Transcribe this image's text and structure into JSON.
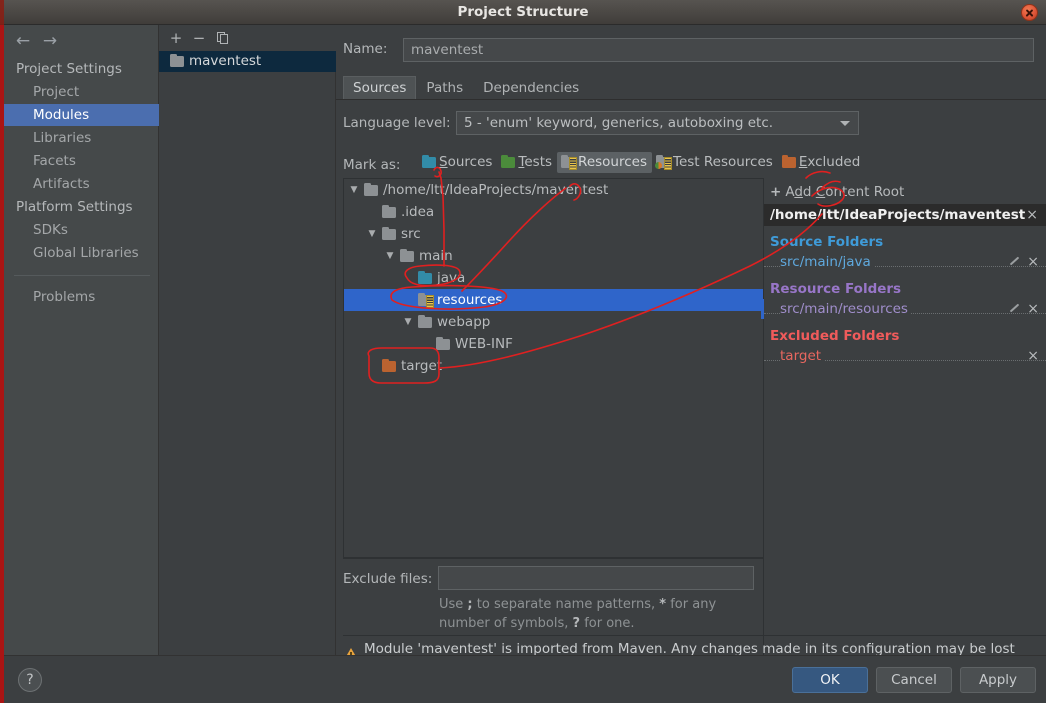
{
  "window": {
    "title": "Project Structure",
    "close_icon": "close-icon"
  },
  "sidebar": {
    "back_icon": "←",
    "forward_icon": "→",
    "groups": [
      {
        "label": "Project Settings"
      },
      {
        "label": "Platform Settings"
      }
    ],
    "items": [
      {
        "label": "Project",
        "selected": false
      },
      {
        "label": "Modules",
        "selected": true
      },
      {
        "label": "Libraries",
        "selected": false
      },
      {
        "label": "Facets",
        "selected": false
      },
      {
        "label": "Artifacts",
        "selected": false
      },
      {
        "label": "SDKs",
        "selected": false
      },
      {
        "label": "Global Libraries",
        "selected": false
      },
      {
        "label": "Problems",
        "selected": false
      }
    ]
  },
  "module_list": {
    "toolbar": {
      "add": "+",
      "remove": "−",
      "copy": "copy-icon"
    },
    "modules": [
      {
        "label": "maventest",
        "selected": true
      }
    ]
  },
  "module_editor": {
    "name_label": "Name:",
    "name_value": "maventest",
    "tabs": [
      {
        "label": "Sources",
        "active": true
      },
      {
        "label": "Paths",
        "active": false
      },
      {
        "label": "Dependencies",
        "active": false
      }
    ],
    "language_level_label": "Language level:",
    "language_level_value": "5 - 'enum' keyword, generics, autoboxing etc.",
    "mark_as_label": "Mark as:",
    "mark_as": [
      {
        "label": "Sources",
        "mnemonic": "S",
        "icon": "folder-sources-icon",
        "active": false
      },
      {
        "label": "Tests",
        "mnemonic": "T",
        "icon": "folder-tests-icon",
        "active": false
      },
      {
        "label": "Resources",
        "mnemonic": "R",
        "icon": "folder-resources-icon",
        "active": true
      },
      {
        "label": "Test Resources",
        "mnemonic": "",
        "icon": "folder-test-resources-icon",
        "active": false
      },
      {
        "label": "Excluded",
        "mnemonic": "E",
        "icon": "folder-excluded-icon",
        "active": false
      }
    ],
    "exclude_files_label": "Exclude files:",
    "exclude_files_value": "",
    "exclude_hint_line1_a": "Use ",
    "exclude_hint_semicolon": ";",
    "exclude_hint_line1_b": " to separate name patterns, ",
    "exclude_hint_star": "*",
    "exclude_hint_line1_c": " for any",
    "exclude_hint_line2_a": "number of symbols, ",
    "exclude_hint_question": "?",
    "exclude_hint_line2_b": " for one.",
    "warning_text": "Module 'maventest' is imported from Maven. Any changes made in its configuration may be lost after reimporting."
  },
  "tree": {
    "nodes": [
      {
        "label": "/home/ltt/IdeaProjects/maventest",
        "depth": 0,
        "twisty": "expanded",
        "icon": "folder-grey-icon",
        "selected": false
      },
      {
        "label": ".idea",
        "depth": 1,
        "twisty": "none",
        "icon": "folder-grey-icon",
        "selected": false
      },
      {
        "label": "src",
        "depth": 1,
        "twisty": "expanded",
        "icon": "folder-grey-icon",
        "selected": false
      },
      {
        "label": "main",
        "depth": 2,
        "twisty": "expanded",
        "icon": "folder-grey-icon",
        "selected": false
      },
      {
        "label": "java",
        "depth": 3,
        "twisty": "none",
        "icon": "folder-sources-icon",
        "selected": false
      },
      {
        "label": "resources",
        "depth": 3,
        "twisty": "none",
        "icon": "folder-resources-icon",
        "selected": true
      },
      {
        "label": "webapp",
        "depth": 3,
        "twisty": "expanded",
        "icon": "folder-grey-icon",
        "selected": false
      },
      {
        "label": "WEB-INF",
        "depth": 4,
        "twisty": "none",
        "icon": "folder-grey-icon",
        "selected": false
      },
      {
        "label": "target",
        "depth": 1,
        "twisty": "none",
        "icon": "folder-excluded-icon",
        "selected": false
      }
    ]
  },
  "content_roots": {
    "add_content_root_label": "Add Content Root",
    "add_content_root_mnemonic": "C",
    "root_path": "/home/ltt/IdeaProjects/maventest",
    "close_icon": "×",
    "groups": [
      {
        "title": "Source Folders",
        "color": "#3f9bd8",
        "items": [
          {
            "label": "src/main/java",
            "has_edit": true,
            "has_remove": true
          }
        ]
      },
      {
        "title": "Resource Folders",
        "color": "#9876c8",
        "items": [
          {
            "label": "src/main/resources",
            "has_edit": true,
            "has_remove": true
          }
        ]
      },
      {
        "title": "Excluded Folders",
        "color": "#f05b5b",
        "items": [
          {
            "label": "target",
            "has_edit": false,
            "has_remove": true
          }
        ]
      }
    ]
  },
  "footer": {
    "help_label": "?",
    "ok_label": "OK",
    "cancel_label": "Cancel",
    "apply_label": "Apply"
  },
  "colors": {
    "accent_blue": "#2f65ca",
    "selection_nav": "#4b6eaf",
    "primary_button": "#365880",
    "annotation_red": "#e02020",
    "warning_amber": "#e8a33d",
    "window_bg": "#3c3f41"
  }
}
